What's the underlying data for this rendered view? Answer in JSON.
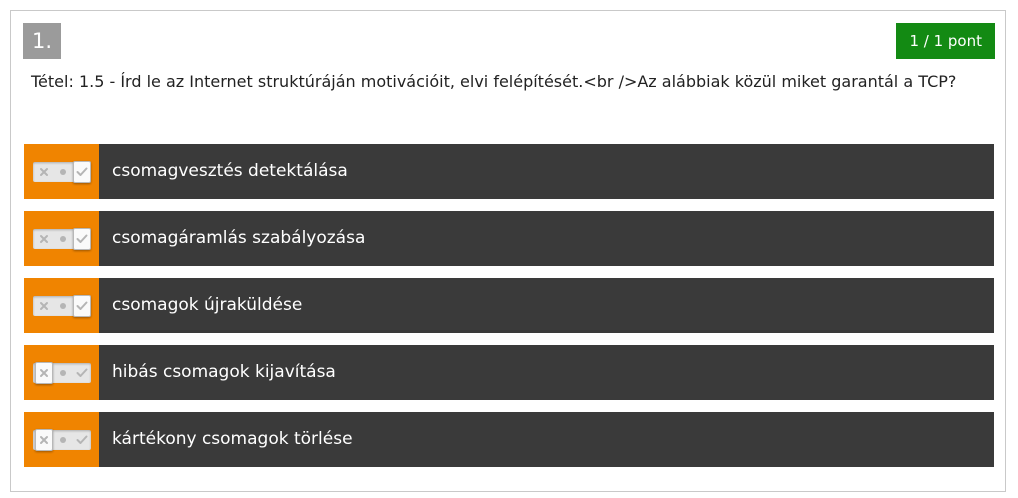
{
  "question": {
    "number": "1.",
    "score": "1 / 1 pont",
    "text": "Tétel: 1.5 - Írd le az Internet struktúráján motivációit, elvi felépítését.<br />Az alábbiak közül miket garantál a TCP?"
  },
  "options": [
    {
      "label": "csomagvesztés detektálása",
      "state": "check"
    },
    {
      "label": "csomagáramlás szabályozása",
      "state": "check"
    },
    {
      "label": "csomagok újraküldése",
      "state": "check"
    },
    {
      "label": "hibás csomagok kijavítása",
      "state": "x"
    },
    {
      "label": "kártékony csomagok törlése",
      "state": "x"
    }
  ],
  "colors": {
    "accent_orange": "#f08400",
    "option_bg": "#3a3a3a",
    "score_green": "#138a13",
    "number_gray": "#9b9b9b"
  },
  "icons": {
    "x": "x-icon",
    "neutral": "neutral-dot-icon",
    "check": "check-icon"
  }
}
